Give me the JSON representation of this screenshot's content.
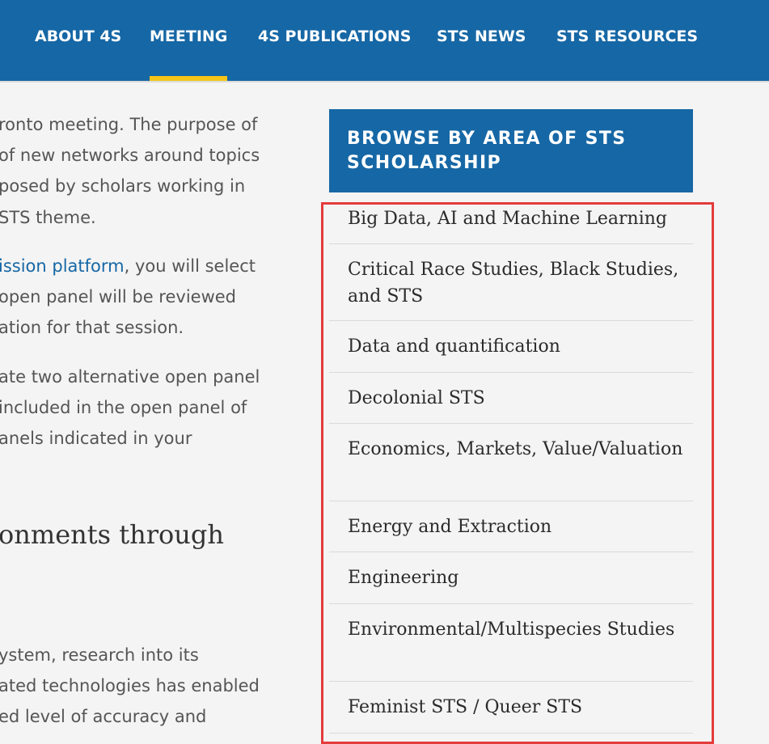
{
  "nav": {
    "items": [
      "ABOUT 4S",
      "MEETING",
      "4S PUBLICATIONS",
      "STS NEWS",
      "STS RESOURCES"
    ],
    "active": "MEETING"
  },
  "main": {
    "paragraph1": [
      "ronto meeting. The purpose of",
      "of new networks around topics",
      "posed by scholars working in",
      "STS theme."
    ],
    "paragraph2_link": "ission platform",
    "paragraph2": [
      ", you will select",
      "open panel will be reviewed",
      "ation for that session."
    ],
    "paragraph3": [
      "ate two alternative open panel",
      "included in the open panel of",
      "anels indicated in your"
    ],
    "heading": "onments through",
    "paragraph4": [
      "ystem, research into its",
      "ated technologies has enabled",
      "ed level of accuracy and"
    ]
  },
  "sidebar": {
    "title": "BROWSE BY AREA OF STS SCHOLARSHIP",
    "items": [
      "Big Data, AI and Machine Learning",
      "Critical Race Studies, Black Studies, and STS",
      "Data and quantification",
      "Decolonial STS",
      "Economics, Markets, Value/Valuation",
      "Energy and Extraction",
      "Engineering",
      "Environmental/Multispecies Studies",
      "Feminist STS / Queer STS"
    ]
  },
  "colors": {
    "brand_blue": "#1667a5",
    "active_underline": "#f5c518",
    "highlight_border": "#e43b3b",
    "background": "#f4f4f4"
  }
}
